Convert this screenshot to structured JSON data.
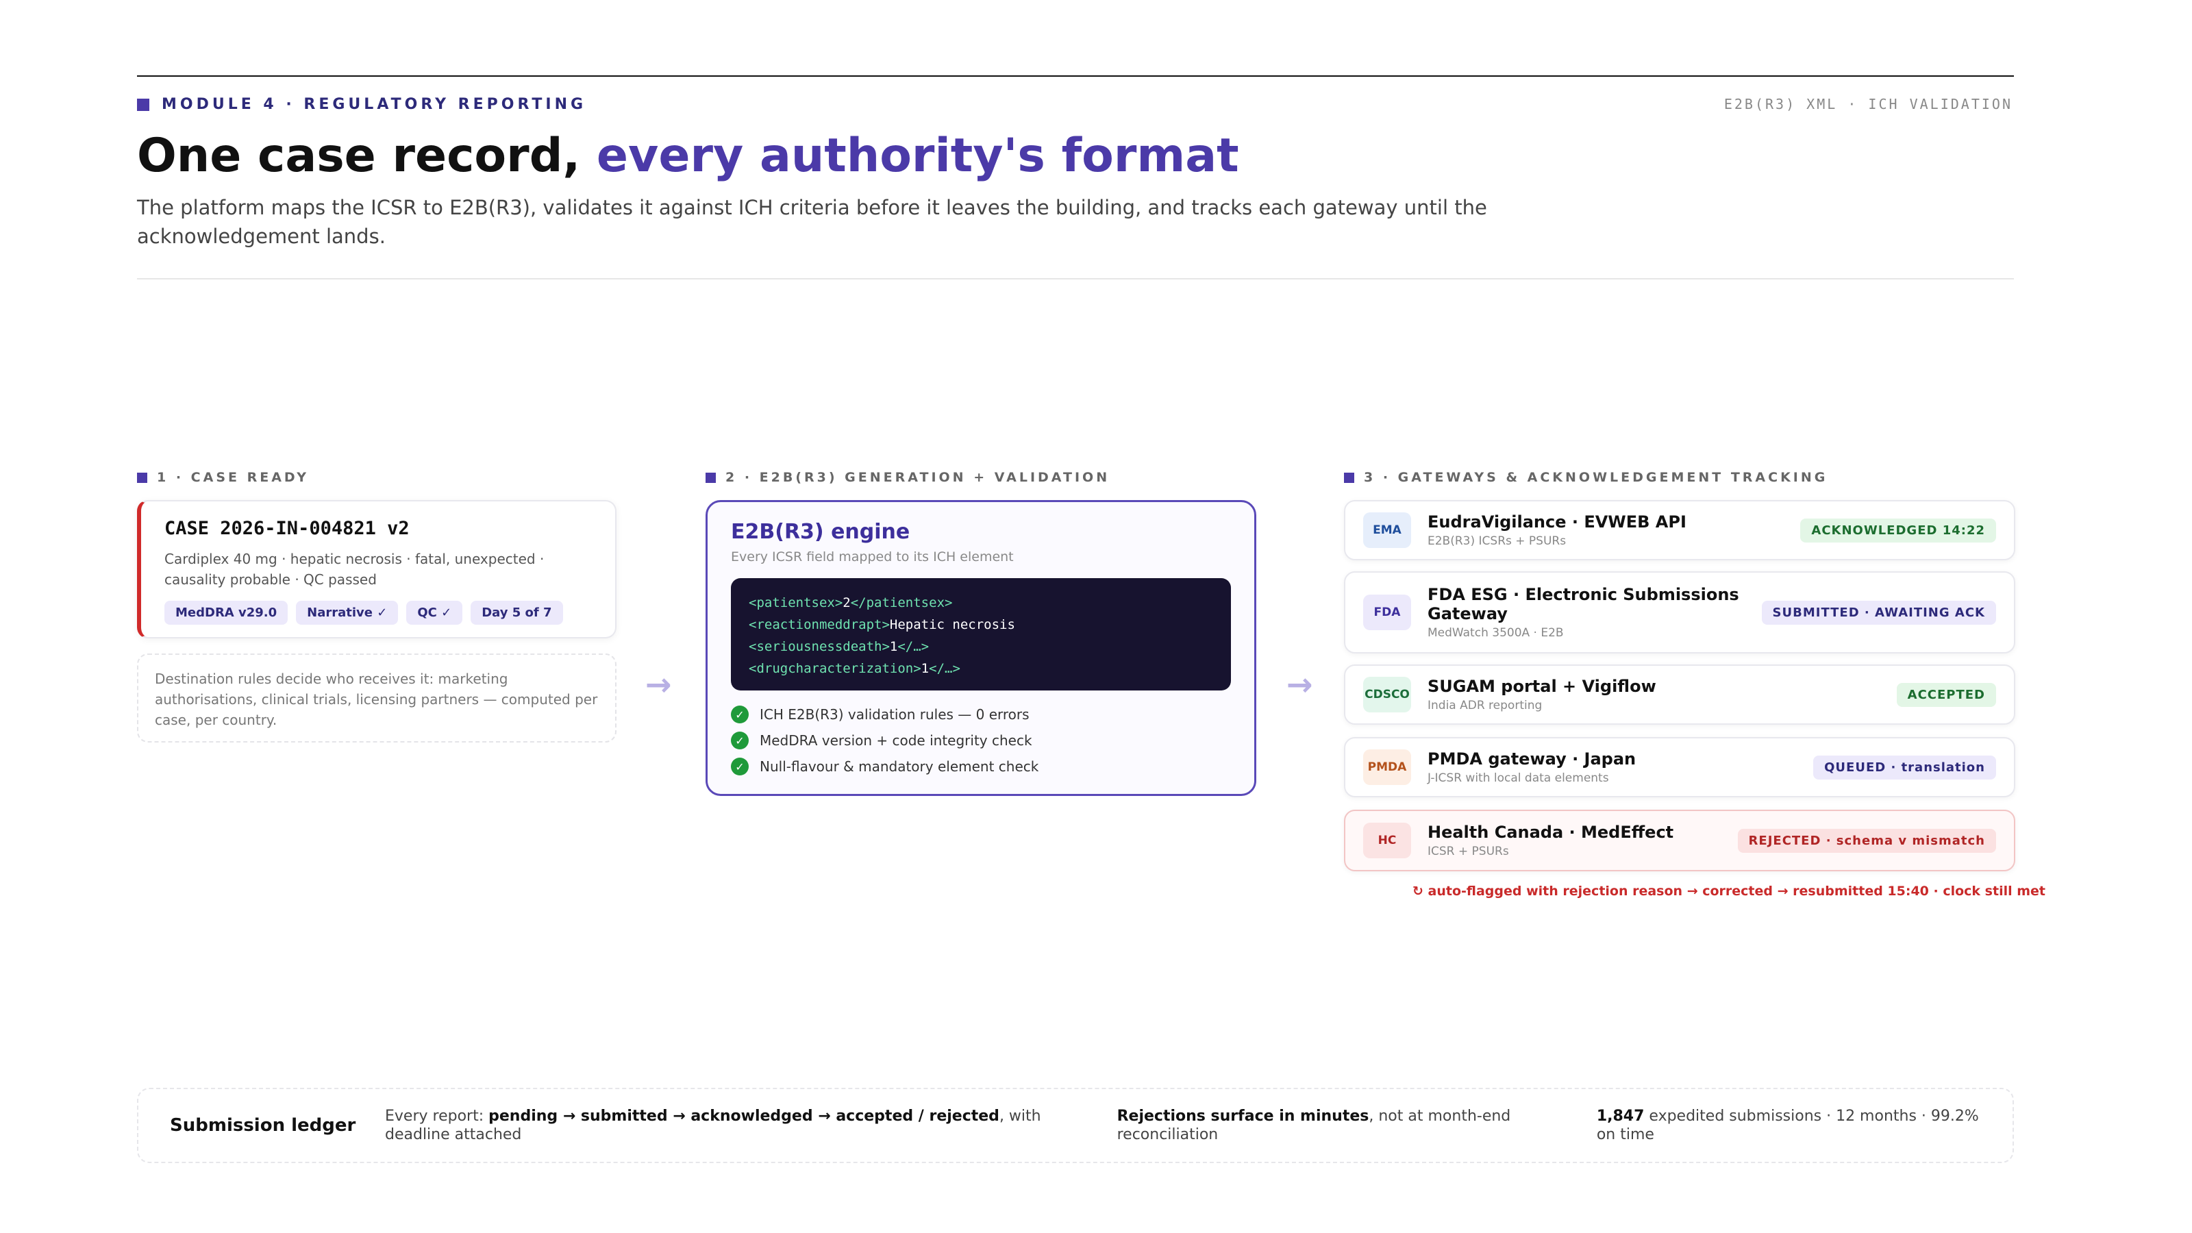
{
  "header": {
    "kicker": "MODULE 4 · REGULATORY REPORTING",
    "tag_right": "E2B(R3) XML · ICH VALIDATION",
    "title_main": "One case record,",
    "title_accent": "every authority's format",
    "subtitle": "The platform maps the ICSR to E2B(R3), validates it against ICH criteria before it leaves the building, and tracks each gateway until the acknowledgement lands."
  },
  "sections": {
    "s1": "1 · CASE READY",
    "s2": "2 · E2B(R3) GENERATION + VALIDATION",
    "s3": "3 · GATEWAYS & ACKNOWLEDGEMENT TRACKING"
  },
  "case": {
    "id": "CASE 2026-IN-004821 v2",
    "desc": "Cardiplex 40 mg · hepatic necrosis · fatal, unexpected · causality probable · QC passed",
    "chips": [
      "MedDRA v29.0",
      "Narrative ✓",
      "QC ✓",
      "Day 5 of 7"
    ],
    "note": "Destination rules decide who receives it: marketing authorisations, clinical trials, licensing partners — computed per case, per country."
  },
  "arrow_glyph": "→",
  "engine": {
    "title": "E2B(R3) engine",
    "subtitle": "Every ICSR field mapped to its ICH element",
    "code": [
      {
        "open": "<patientsex>",
        "value": "2",
        "close": "</patientsex>"
      },
      {
        "open": "<reactionmeddrapt>",
        "value": "Hepatic necrosis",
        "close": ""
      },
      {
        "open": "<seriousnessdeath>",
        "value": "1",
        "close": "</…>"
      },
      {
        "open": "<drugcharacterization>",
        "value": "1",
        "close": "</…>"
      }
    ],
    "check_glyph": "✓",
    "checks": [
      "ICH E2B(R3) validation rules — 0 errors",
      "MedDRA version + code integrity check",
      "Null-flavour & mandatory element check"
    ]
  },
  "gateways": [
    {
      "code": "EMA",
      "name": "EudraVigilance · EVWEB API",
      "sub": "E2B(R3) ICSRs + PSURs",
      "status": "ACKNOWLEDGED 14:22",
      "logo_bg": "#e6eefb",
      "logo_fg": "#1f4e9c",
      "st_bg": "#e3f6e6",
      "st_fg": "#1c6d2f"
    },
    {
      "code": "FDA",
      "name": "FDA ESG · Electronic Submissions Gateway",
      "sub": "MedWatch 3500A · E2B",
      "status": "SUBMITTED · AWAITING ACK",
      "logo_bg": "#ece9fb",
      "logo_fg": "#3d2f9c",
      "st_bg": "#ece9fb",
      "st_fg": "#2d2a7a"
    },
    {
      "code": "CDSCO",
      "name": "SUGAM portal + Vigiflow",
      "sub": "India ADR reporting",
      "status": "ACCEPTED",
      "logo_bg": "#e3f6ec",
      "logo_fg": "#1c6d3a",
      "st_bg": "#e3f6e6",
      "st_fg": "#1c6d2f"
    },
    {
      "code": "PMDA",
      "name": "PMDA gateway · Japan",
      "sub": "J-ICSR with local data elements",
      "status": "QUEUED · translation",
      "logo_bg": "#fdeee4",
      "logo_fg": "#b4521c",
      "st_bg": "#ece9fb",
      "st_fg": "#2d2a7a"
    },
    {
      "code": "HC",
      "name": "Health Canada · MedEffect",
      "sub": "ICSR + PSURs",
      "status": "REJECTED · schema v mismatch",
      "logo_bg": "#fbe3e3",
      "logo_fg": "#b02525",
      "st_bg": "#fbe1e1",
      "st_fg": "#b02525"
    }
  ],
  "rejection_note": "↻ auto-flagged with rejection reason → corrected → resubmitted 15:40 · clock still met",
  "ledger": {
    "heading": "Submission ledger",
    "c1_lead": "Every report: ",
    "c1_bold": "pending → submitted → acknowledged → accepted / rejected",
    "c1_tail": ", with deadline attached",
    "c2_bold": "Rejections surface in minutes",
    "c2_tail": ", not at month-end reconciliation",
    "c3_bold": "1,847",
    "c3_tail": " expedited submissions · 12 months · 99.2% on time"
  }
}
